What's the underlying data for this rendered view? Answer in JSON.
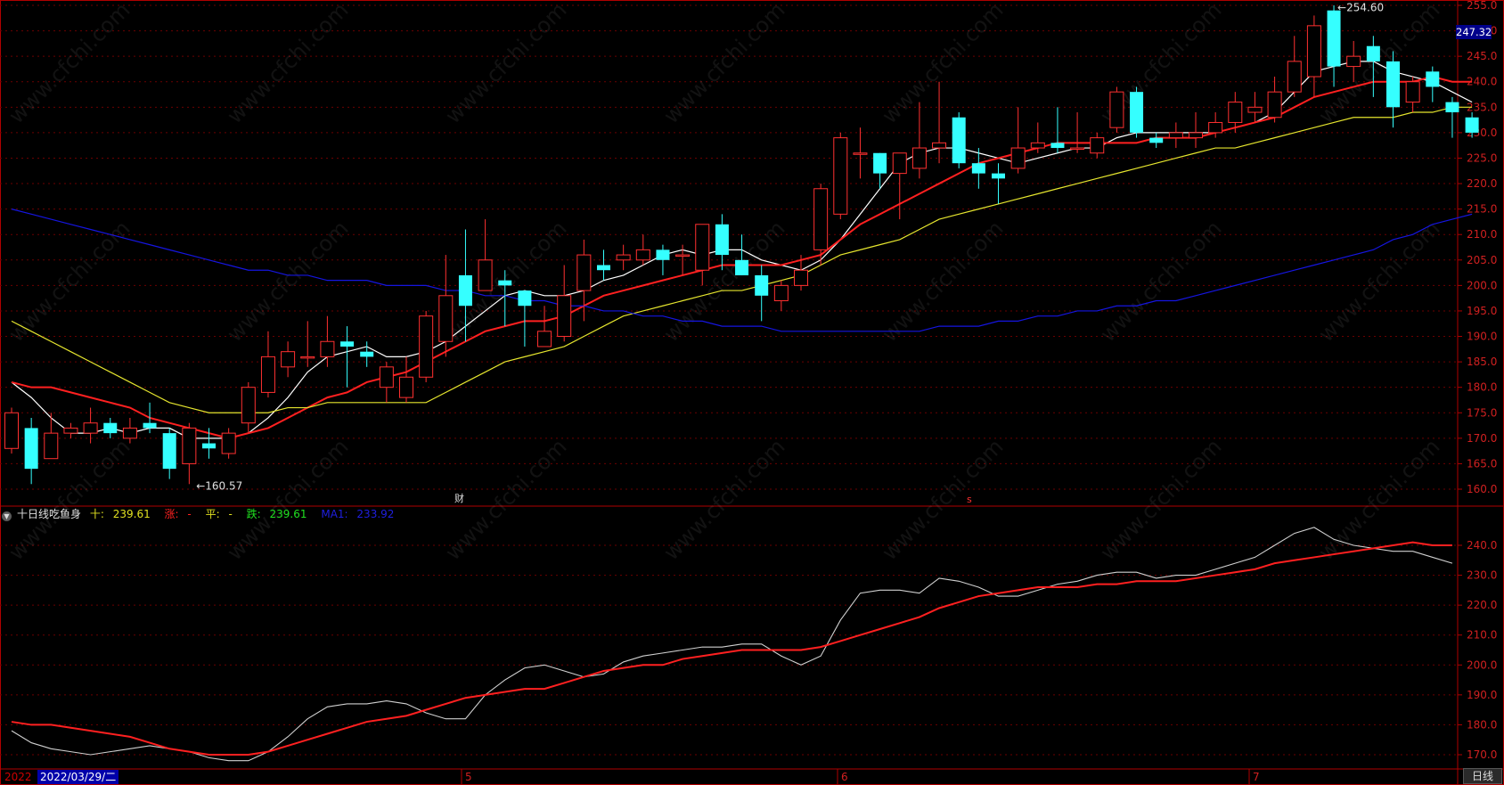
{
  "chart_data": [
    {
      "type": "candlestick",
      "y_ticks": [
        160.0,
        165.0,
        170.0,
        175.0,
        180.0,
        185.0,
        190.0,
        195.0,
        200.0,
        205.0,
        210.0,
        215.0,
        220.0,
        225.0,
        230.0,
        235.0,
        240.0,
        245.0,
        250.0,
        255.0
      ],
      "current_price_label": "247.32",
      "high_label": "254.60",
      "low_label": "160.57",
      "candles": [
        [
          168.0,
          175.0,
          176.0,
          167.0
        ],
        [
          172.0,
          164.0,
          174.0,
          161.0
        ],
        [
          166.0,
          171.0,
          175.0,
          166.0
        ],
        [
          171.0,
          172.0,
          173.0,
          170.0
        ],
        [
          171.0,
          173.0,
          176.0,
          169.0
        ],
        [
          173.0,
          171.0,
          174.0,
          170.0
        ],
        [
          170.0,
          172.0,
          174.0,
          169.0
        ],
        [
          173.0,
          172.0,
          177.0,
          171.0
        ],
        [
          171.0,
          164.0,
          172.0,
          162.0
        ],
        [
          165.0,
          172.0,
          173.0,
          161.0
        ],
        [
          169.0,
          168.0,
          172.0,
          166.0
        ],
        [
          167.0,
          171.0,
          172.0,
          166.0
        ],
        [
          173.0,
          180.0,
          181.0,
          171.0
        ],
        [
          179.0,
          186.0,
          191.0,
          178.0
        ],
        [
          184.0,
          187.0,
          189.0,
          182.0
        ],
        [
          186.0,
          186.0,
          193.0,
          184.0
        ],
        [
          186.0,
          189.0,
          194.0,
          184.0
        ],
        [
          189.0,
          188.0,
          192.0,
          180.0
        ],
        [
          187.0,
          186.0,
          189.0,
          184.0
        ],
        [
          180.0,
          184.0,
          185.0,
          177.0
        ],
        [
          178.0,
          182.0,
          186.0,
          177.0
        ],
        [
          182.0,
          194.0,
          195.0,
          181.0
        ],
        [
          189.0,
          198.0,
          206.0,
          186.0
        ],
        [
          202.0,
          196.0,
          211.0,
          189.0
        ],
        [
          199.0,
          205.0,
          213.0,
          199.0
        ],
        [
          201.0,
          200.0,
          203.0,
          192.0
        ],
        [
          199.0,
          196.0,
          199.0,
          188.0
        ],
        [
          188.0,
          191.0,
          196.0,
          188.0
        ],
        [
          190.0,
          198.0,
          204.0,
          189.0
        ],
        [
          199.0,
          206.0,
          209.0,
          193.0
        ],
        [
          204.0,
          203.0,
          207.0,
          201.0
        ],
        [
          205.0,
          206.0,
          208.0,
          203.0
        ],
        [
          205.0,
          207.0,
          210.0,
          204.0
        ],
        [
          207.0,
          205.0,
          208.0,
          202.0
        ],
        [
          206.0,
          206.0,
          208.0,
          202.0
        ],
        [
          203.0,
          212.0,
          212.0,
          200.0
        ],
        [
          212.0,
          206.0,
          214.0,
          203.0
        ],
        [
          205.0,
          202.0,
          210.0,
          202.0
        ],
        [
          202.0,
          198.0,
          204.0,
          193.0
        ],
        [
          197.0,
          200.0,
          201.0,
          195.0
        ],
        [
          200.0,
          203.0,
          206.0,
          199.0
        ],
        [
          207.0,
          219.0,
          220.0,
          204.0
        ],
        [
          214.0,
          229.0,
          230.0,
          213.0
        ],
        [
          226.0,
          226.0,
          231.0,
          221.0
        ],
        [
          226.0,
          222.0,
          226.0,
          219.0
        ],
        [
          222.0,
          226.0,
          226.0,
          213.0
        ],
        [
          223.0,
          227.0,
          236.0,
          221.0
        ],
        [
          227.0,
          228.0,
          240.0,
          224.0
        ],
        [
          233.0,
          224.0,
          234.0,
          223.0
        ],
        [
          224.0,
          222.0,
          227.0,
          219.0
        ],
        [
          222.0,
          221.0,
          224.0,
          216.0
        ],
        [
          223.0,
          227.0,
          235.0,
          222.0
        ],
        [
          227.0,
          228.0,
          232.0,
          226.0
        ],
        [
          228.0,
          227.0,
          235.0,
          226.0
        ],
        [
          227.0,
          227.0,
          234.0,
          226.0
        ],
        [
          226.0,
          229.0,
          230.0,
          225.0
        ],
        [
          231.0,
          238.0,
          239.0,
          230.0
        ],
        [
          238.0,
          230.0,
          239.0,
          229.0
        ],
        [
          229.0,
          228.0,
          230.0,
          227.0
        ],
        [
          229.0,
          230.0,
          232.0,
          227.0
        ],
        [
          229.0,
          230.0,
          234.0,
          227.0
        ],
        [
          230.0,
          232.0,
          234.0,
          229.0
        ],
        [
          232.0,
          236.0,
          238.0,
          230.0
        ],
        [
          234.0,
          235.0,
          238.0,
          232.0
        ],
        [
          233.0,
          238.0,
          241.0,
          232.0
        ],
        [
          238.0,
          244.0,
          249.0,
          237.0
        ],
        [
          241.0,
          251.0,
          253.0,
          237.0
        ],
        [
          254.0,
          243.0,
          255.0,
          239.0
        ],
        [
          243.0,
          245.0,
          248.0,
          240.0
        ],
        [
          247.0,
          244.0,
          249.0,
          237.0
        ],
        [
          244.0,
          235.0,
          246.0,
          231.0
        ],
        [
          236.0,
          240.0,
          241.0,
          234.0
        ],
        [
          242.0,
          239.0,
          243.0,
          236.0
        ],
        [
          236.0,
          234.0,
          237.0,
          229.0
        ],
        [
          233.0,
          230.0,
          234.0,
          229.0
        ]
      ],
      "ma_series": [
        {
          "color": "#ffffff",
          "values": [
            181.0,
            178.0,
            174.0,
            171.0,
            171.0,
            172.0,
            171.0,
            172.0,
            172.0,
            170.0,
            170.0,
            170.0,
            171.0,
            174.0,
            178.0,
            183.0,
            186.0,
            187.0,
            188.0,
            186.0,
            186.0,
            187.0,
            189.0,
            192.0,
            195.0,
            198.0,
            199.0,
            198.0,
            198.0,
            199.0,
            201.0,
            202.0,
            204.0,
            206.0,
            207.0,
            206.0,
            207.0,
            207.0,
            205.0,
            204.0,
            203.0,
            205.0,
            209.0,
            214.0,
            219.0,
            224.0,
            226.0,
            227.0,
            227.0,
            226.0,
            225.0,
            224.0,
            225.0,
            226.0,
            227.0,
            227.0,
            229.0,
            230.0,
            230.0,
            230.0,
            230.0,
            230.0,
            231.0,
            232.0,
            234.0,
            238.0,
            242.0,
            243.0,
            244.0,
            244.0,
            242.0,
            241.0,
            240.0,
            238.0,
            236.0
          ]
        },
        {
          "color": "#ff2020",
          "values": [
            181.0,
            180.0,
            180.0,
            179.0,
            178.0,
            177.0,
            176.0,
            174.0,
            173.0,
            172.0,
            171.0,
            170.0,
            171.0,
            172.0,
            174.0,
            176.0,
            178.0,
            179.0,
            181.0,
            182.0,
            183.0,
            185.0,
            187.0,
            189.0,
            191.0,
            192.0,
            193.0,
            193.0,
            194.0,
            196.0,
            198.0,
            199.0,
            200.0,
            201.0,
            202.0,
            203.0,
            204.0,
            204.0,
            204.0,
            204.0,
            205.0,
            206.0,
            209.0,
            212.0,
            214.0,
            216.0,
            218.0,
            220.0,
            222.0,
            224.0,
            225.0,
            226.0,
            227.0,
            228.0,
            228.0,
            228.0,
            228.0,
            228.0,
            229.0,
            229.0,
            229.0,
            230.0,
            231.0,
            232.0,
            233.0,
            235.0,
            237.0,
            238.0,
            239.0,
            240.0,
            240.0,
            240.0,
            241.0,
            240.0,
            240.0
          ]
        },
        {
          "color": "#e5e52e",
          "values": [
            193.0,
            191.0,
            189.0,
            187.0,
            185.0,
            183.0,
            181.0,
            179.0,
            177.0,
            176.0,
            175.0,
            175.0,
            175.0,
            175.0,
            176.0,
            176.0,
            177.0,
            177.0,
            177.0,
            177.0,
            177.0,
            177.0,
            179.0,
            181.0,
            183.0,
            185.0,
            186.0,
            187.0,
            188.0,
            190.0,
            192.0,
            194.0,
            195.0,
            196.0,
            197.0,
            198.0,
            199.0,
            199.0,
            200.0,
            201.0,
            202.0,
            204.0,
            206.0,
            207.0,
            208.0,
            209.0,
            211.0,
            213.0,
            214.0,
            215.0,
            216.0,
            217.0,
            218.0,
            219.0,
            220.0,
            221.0,
            222.0,
            223.0,
            224.0,
            225.0,
            226.0,
            227.0,
            227.0,
            228.0,
            229.0,
            230.0,
            231.0,
            232.0,
            233.0,
            233.0,
            233.0,
            234.0,
            234.0,
            235.0,
            235.0
          ]
        },
        {
          "color": "#1515e0",
          "values": [
            215.0,
            214.0,
            213.0,
            212.0,
            211.0,
            210.0,
            209.0,
            208.0,
            207.0,
            206.0,
            205.0,
            204.0,
            203.0,
            203.0,
            202.0,
            202.0,
            201.0,
            201.0,
            201.0,
            200.0,
            200.0,
            200.0,
            199.0,
            199.0,
            198.0,
            198.0,
            197.0,
            197.0,
            196.0,
            196.0,
            195.0,
            195.0,
            194.0,
            194.0,
            193.0,
            193.0,
            192.0,
            192.0,
            192.0,
            191.0,
            191.0,
            191.0,
            191.0,
            191.0,
            191.0,
            191.0,
            191.0,
            192.0,
            192.0,
            192.0,
            193.0,
            193.0,
            194.0,
            194.0,
            195.0,
            195.0,
            196.0,
            196.0,
            197.0,
            197.0,
            198.0,
            199.0,
            200.0,
            201.0,
            202.0,
            203.0,
            204.0,
            205.0,
            206.0,
            207.0,
            209.0,
            210.0,
            212.0,
            213.0,
            214.0
          ]
        }
      ]
    },
    {
      "type": "line",
      "title": "十日线吃鱼身",
      "legend": [
        {
          "label": "十:",
          "value": "239.61",
          "color": "#e0e020"
        },
        {
          "label": "涨:",
          "value": "-",
          "color": "#ff2020"
        },
        {
          "label": "平:",
          "value": "-",
          "color": "#e0e020"
        },
        {
          "label": "跌:",
          "value": "239.61",
          "color": "#20e020"
        },
        {
          "label": "MA1:",
          "value": "233.92",
          "color": "#1f1fe0"
        }
      ],
      "y_ticks": [
        170.0,
        180.0,
        190.0,
        200.0,
        210.0,
        220.0,
        230.0,
        240.0
      ],
      "series": [
        {
          "color": "#d0d0d0",
          "values": [
            178.0,
            174.0,
            172.0,
            171.0,
            170.0,
            171.0,
            172.0,
            173.0,
            172.0,
            171.0,
            169.0,
            168.0,
            168.0,
            171.0,
            176.0,
            182.0,
            186.0,
            187.0,
            187.0,
            188.0,
            187.0,
            184.0,
            182.0,
            182.0,
            190.0,
            195.0,
            199.0,
            200.0,
            198.0,
            196.0,
            197.0,
            201.0,
            203.0,
            204.0,
            205.0,
            206.0,
            206.0,
            207.0,
            207.0,
            203.0,
            200.0,
            203.0,
            215.0,
            224.0,
            225.0,
            225.0,
            224.0,
            229.0,
            228.0,
            226.0,
            223.0,
            223.0,
            225.0,
            227.0,
            228.0,
            230.0,
            231.0,
            231.0,
            229.0,
            230.0,
            230.0,
            232.0,
            234.0,
            236.0,
            240.0,
            244.0,
            246.0,
            242.0,
            240.0,
            239.0,
            238.0,
            238.0,
            236.0,
            234.0
          ]
        },
        {
          "color": "#ff2020",
          "values": [
            181.0,
            180.0,
            180.0,
            179.0,
            178.0,
            177.0,
            176.0,
            174.0,
            172.0,
            171.0,
            170.0,
            170.0,
            170.0,
            171.0,
            173.0,
            175.0,
            177.0,
            179.0,
            181.0,
            182.0,
            183.0,
            185.0,
            187.0,
            189.0,
            190.0,
            191.0,
            192.0,
            192.0,
            194.0,
            196.0,
            198.0,
            199.0,
            200.0,
            200.0,
            202.0,
            203.0,
            204.0,
            205.0,
            205.0,
            205.0,
            205.0,
            206.0,
            208.0,
            210.0,
            212.0,
            214.0,
            216.0,
            219.0,
            221.0,
            223.0,
            224.0,
            225.0,
            226.0,
            226.0,
            226.0,
            227.0,
            227.0,
            228.0,
            228.0,
            228.0,
            229.0,
            230.0,
            231.0,
            232.0,
            234.0,
            235.0,
            236.0,
            237.0,
            238.0,
            239.0,
            240.0,
            241.0,
            240.0,
            240.0
          ]
        }
      ]
    }
  ],
  "markers": {
    "cai": "财",
    "s": "s"
  },
  "x_labels": [
    "2022",
    "2022/03/29/二",
    "5",
    "6",
    "7"
  ],
  "period_label": "日线",
  "watermark": "www.cfchi.com"
}
